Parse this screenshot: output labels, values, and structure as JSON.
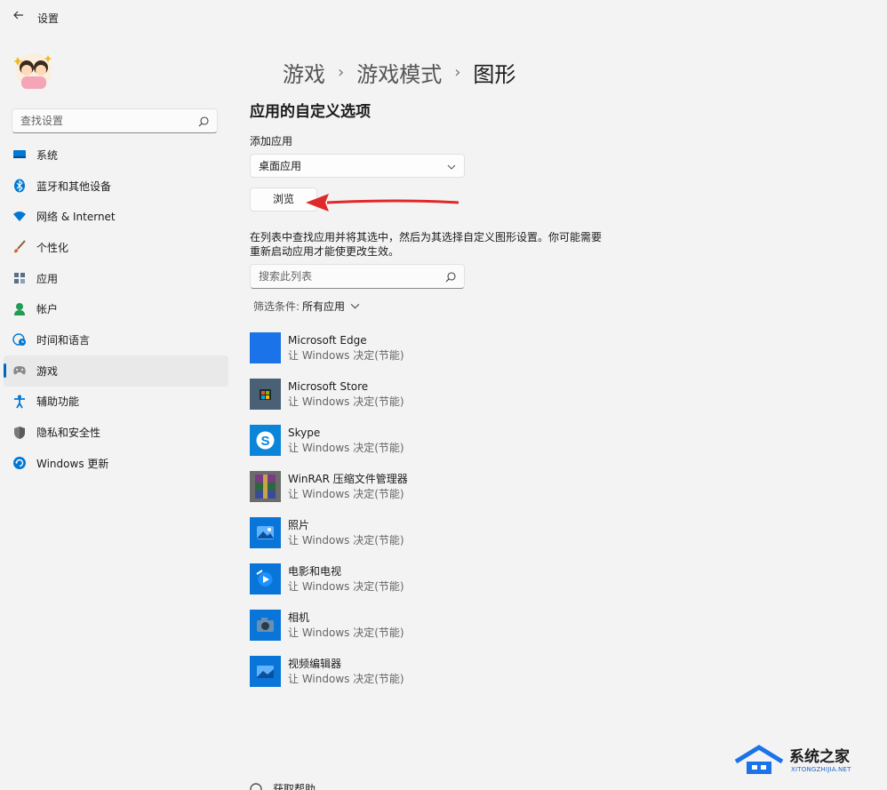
{
  "window": {
    "title": "设置",
    "back_icon": "back-arrow-icon"
  },
  "search": {
    "placeholder": "查找设置"
  },
  "sidebar": {
    "items": [
      {
        "label": "系统",
        "icon": "monitor-icon",
        "color": "#0078d4"
      },
      {
        "label": "蓝牙和其他设备",
        "icon": "bluetooth-icon",
        "color": "#0078d4"
      },
      {
        "label": "网络 & Internet",
        "icon": "wifi-icon",
        "color": "#0078d4"
      },
      {
        "label": "个性化",
        "icon": "brush-icon",
        "color": "#d56a2a"
      },
      {
        "label": "应用",
        "icon": "apps-icon",
        "color": "#5a6e86"
      },
      {
        "label": "帐户",
        "icon": "account-icon",
        "color": "#1f9d55"
      },
      {
        "label": "时间和语言",
        "icon": "globe-clock-icon",
        "color": "#0078d4"
      },
      {
        "label": "游戏",
        "icon": "gamepad-icon",
        "color": "#777777",
        "active": true
      },
      {
        "label": "辅助功能",
        "icon": "accessibility-icon",
        "color": "#0078d4"
      },
      {
        "label": "隐私和安全性",
        "icon": "shield-icon",
        "color": "#6b6b6b"
      },
      {
        "label": "Windows 更新",
        "icon": "update-icon",
        "color": "#0078d4"
      }
    ]
  },
  "breadcrumb": {
    "part1": "游戏",
    "part2": "游戏模式",
    "current": "图形",
    "separator": "›"
  },
  "section": {
    "title": "应用的自定义选项"
  },
  "add_app": {
    "label": "添加应用",
    "selected": "桌面应用",
    "browse_label": "浏览"
  },
  "description": "在列表中查找应用并将其选中，然后为其选择自定义图形设置。你可能需要重新启动应用才能使更改生效。",
  "list_search": {
    "placeholder": "搜索此列表"
  },
  "filter": {
    "label": "筛选条件:",
    "value": "所有应用"
  },
  "apps": [
    {
      "name": "Microsoft Edge",
      "status": "让 Windows 决定(节能)",
      "icon": "edge-icon",
      "color": "#1a73e8"
    },
    {
      "name": "Microsoft Store",
      "status": "让 Windows 决定(节能)",
      "icon": "store-icon",
      "color": "#4a6075"
    },
    {
      "name": "Skype",
      "status": "让 Windows 决定(节能)",
      "icon": "skype-icon",
      "color": "#0a85d9"
    },
    {
      "name": "WinRAR 压缩文件管理器",
      "status": "让 Windows 决定(节能)",
      "icon": "winrar-icon",
      "color": "#7a3a86"
    },
    {
      "name": "照片",
      "status": "让 Windows 决定(节能)",
      "icon": "photos-icon",
      "color": "#0a75d8"
    },
    {
      "name": "电影和电视",
      "status": "让 Windows 决定(节能)",
      "icon": "movies-icon",
      "color": "#0a75d8"
    },
    {
      "name": "相机",
      "status": "让 Windows 决定(节能)",
      "icon": "camera-icon",
      "color": "#0a75d8"
    },
    {
      "name": "视频编辑器",
      "status": "让 Windows 决定(节能)",
      "icon": "video-editor-icon",
      "color": "#0a75d8"
    }
  ],
  "help": {
    "label": "获取帮助"
  },
  "watermark": {
    "title": "系统之家",
    "subtitle": "XITONGZHIJIA.NET"
  },
  "colors": {
    "accent": "#0067c0",
    "annotation_arrow": "#e02a2a",
    "background": "#f3f3f3"
  }
}
